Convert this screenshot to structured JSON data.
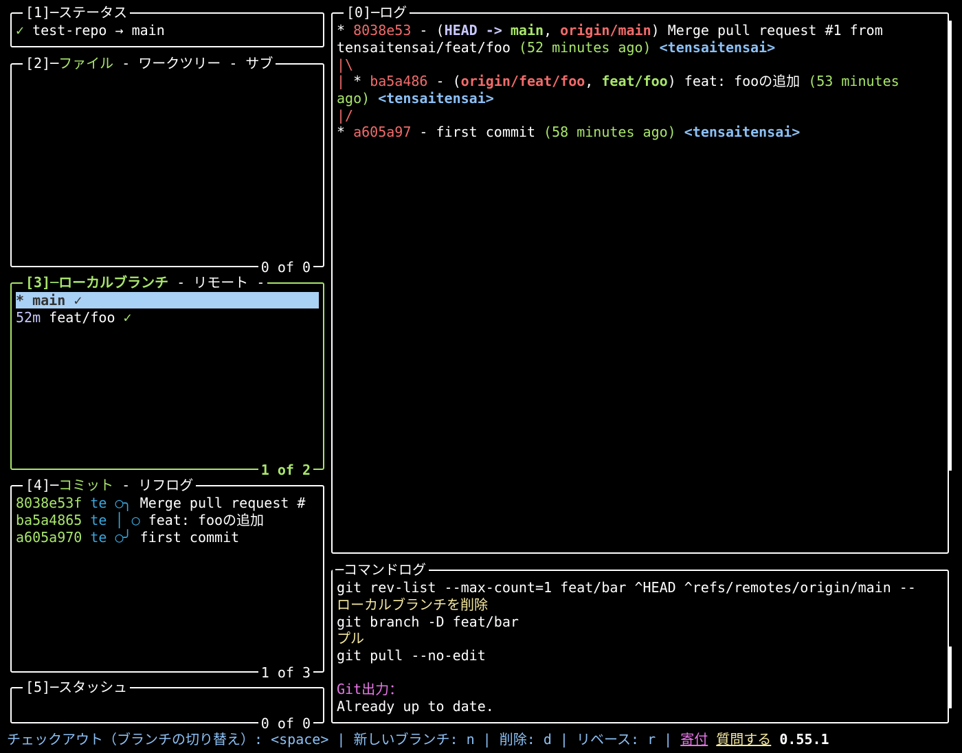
{
  "status": {
    "title": "[1]─ステータス",
    "check": "✓",
    "repo_text": "test-repo → main"
  },
  "files": {
    "title_num": "[2]─",
    "title_active": "ファイル",
    "title_rest": " - ワークツリー - サブ",
    "count": "0 of 0"
  },
  "branches": {
    "title": "[3]─ローカルブランチ",
    "title_rest": " - リモート - ",
    "count": "1 of 2",
    "items": [
      {
        "age": "  * ",
        "name": "main ",
        "check": "✓"
      },
      {
        "age": "52m ",
        "name": "feat/foo ",
        "check": "✓"
      }
    ]
  },
  "commits": {
    "title_num": "[4]─",
    "title_active": "コミット",
    "title_rest": " - リフログ",
    "count": "1 of 3",
    "items": [
      {
        "hash": "8038e53f",
        "author": "te",
        "graph": "○╮",
        "msg": "Merge pull request #"
      },
      {
        "hash": "ba5a4865",
        "author": "te",
        "graph": "│ ○",
        "msg": "feat: fooの追加"
      },
      {
        "hash": "a605a970",
        "author": "te",
        "graph": "○╯",
        "msg": "first commit"
      }
    ]
  },
  "stash": {
    "title": "[5]─スタッシュ",
    "count": "0 of 0"
  },
  "log": {
    "title": "[0]─ログ",
    "l1_star": "*   ",
    "l1_hash": "8038e53",
    "l1_dash": " - (",
    "l1_head": "HEAD -> ",
    "l1_main": "main",
    "l1_comma": ", ",
    "l1_origin": "origin/main",
    "l1_msg": ") Merge pull request #1 from",
    "l2_text": "tensaitensai/feat/foo ",
    "l2_time": "(52 minutes ago)",
    "l2_author": "<tensaitensai>",
    "l3_graph": "|\\",
    "l4_graph": "| ",
    "l4_star": "* ",
    "l4_hash": "ba5a486",
    "l4_dash": " - (",
    "l4_origin": "origin/feat/foo",
    "l4_comma": ", ",
    "l4_feat": "feat/foo",
    "l4_msg": ") feat: fooの追加 ",
    "l4_time": "(53 minutes",
    "l5_time": "ago)",
    "l5_author": "<tensaitensai>",
    "l6_graph": "|/",
    "l7_star": "* ",
    "l7_hash": "a605a97",
    "l7_msg": " - first commit ",
    "l7_time": "(58 minutes ago)",
    "l7_author": "<tensaitensai>"
  },
  "cmdlog": {
    "title": "─コマンドログ",
    "lines": [
      {
        "text": "  git rev-list --max-count=1 feat/bar ^HEAD ^refs/remotes/origin/main --",
        "style": "white"
      },
      {
        "text": "ローカルブランチを削除",
        "style": "yellow"
      },
      {
        "text": "  git branch -D feat/bar",
        "style": "white"
      },
      {
        "text": "プル",
        "style": "yellow"
      },
      {
        "text": "  git pull --no-edit",
        "style": "white"
      },
      {
        "text": "",
        "style": "white"
      },
      {
        "text": "Git出力：",
        "style": "magenta"
      },
      {
        "text": "Already up to date.",
        "style": "white"
      }
    ]
  },
  "footer": {
    "keys": "チェックアウト（ブランチの切り替え）: <space> | 新しいブランチ: n | 削除: d | リベース: r | ",
    "donate": "寄付",
    "ask": "質問する",
    "version": "0.55.1"
  },
  "colors": {
    "accent_green": "#a9e66b",
    "hash_red": "#f26b6b",
    "author_blue": "#8cc0f5",
    "selection": "#a9d0f5"
  }
}
